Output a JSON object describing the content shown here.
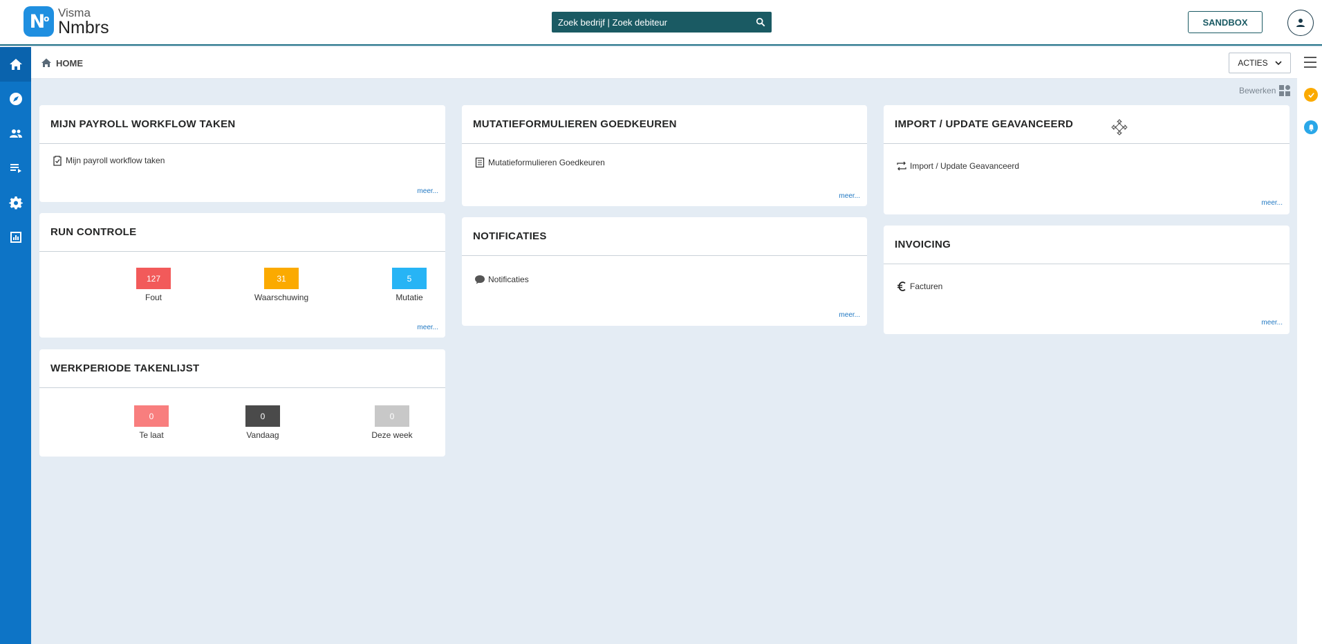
{
  "header": {
    "logo_top": "Visma",
    "logo_bottom": "Nmbrs",
    "search_placeholder": "Zoek bedrijf | Zoek debiteur",
    "sandbox_label": "SANDBOX"
  },
  "breadcrumb": {
    "home": "HOME"
  },
  "actions": {
    "label": "ACTIES",
    "edit_label": "Bewerken"
  },
  "nav": [
    "home-icon",
    "compass-icon",
    "people-icon",
    "list-icon",
    "gear-icon",
    "chart-icon"
  ],
  "colors": {
    "nav_blue": "#0d74c6",
    "search_bg": "#1a5a63",
    "fout": "#f25a5a",
    "waarschuwing": "#fbaa00",
    "mutatie": "#27b4f5",
    "te_laat": "#f87e7e",
    "vandaag": "#4a4a4a",
    "deze_week": "#c8c8c8",
    "status_check": "#fbaa00",
    "status_bell": "#2aa7e8"
  },
  "cards": {
    "workflow": {
      "title": "MIJN PAYROLL WORKFLOW TAKEN",
      "item": "Mijn payroll workflow taken",
      "more": "meer..."
    },
    "run": {
      "title": "RUN CONTROLE",
      "stats": [
        {
          "value": "127",
          "label": "Fout"
        },
        {
          "value": "31",
          "label": "Waarschuwing"
        },
        {
          "value": "5",
          "label": "Mutatie"
        }
      ],
      "more": "meer..."
    },
    "werkperiode": {
      "title": "WERKPERIODE TAKENLIJST",
      "stats": [
        {
          "value": "0",
          "label": "Te laat"
        },
        {
          "value": "0",
          "label": "Vandaag"
        },
        {
          "value": "0",
          "label": "Deze week"
        }
      ]
    },
    "mutatie": {
      "title": "MUTATIEFORMULIEREN GOEDKEUREN",
      "item": "Mutatieformulieren Goedkeuren",
      "more": "meer..."
    },
    "notificaties": {
      "title": "NOTIFICATIES",
      "item": "Notificaties",
      "more": "meer..."
    },
    "import": {
      "title": "IMPORT / UPDATE GEAVANCEERD",
      "item": "Import / Update Geavanceerd",
      "more": "meer..."
    },
    "invoicing": {
      "title": "INVOICING",
      "item": "Facturen",
      "more": "meer..."
    }
  }
}
